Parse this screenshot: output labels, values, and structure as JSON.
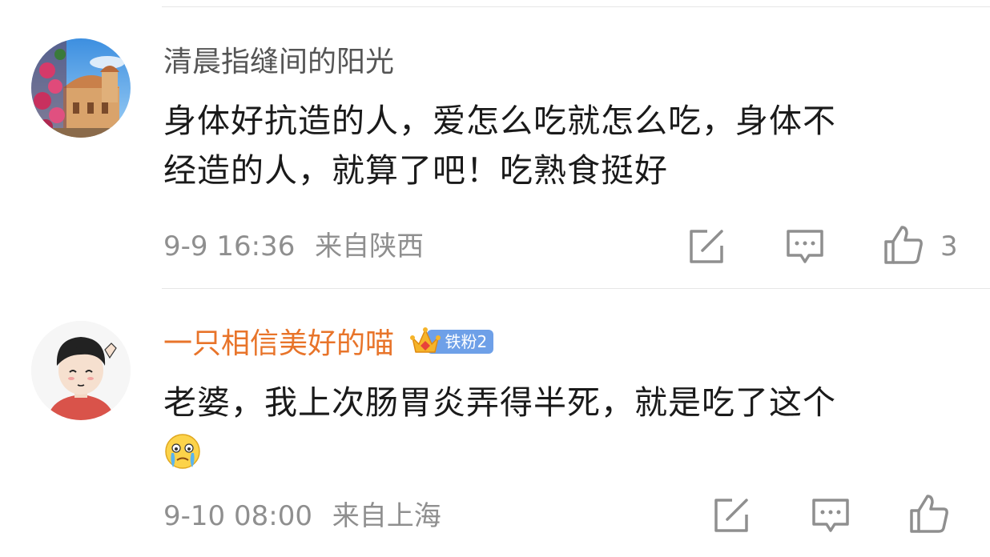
{
  "comments": [
    {
      "username": "清晨指缝间的阳光",
      "username_color": "#555555",
      "lines": [
        "身体好抗造的人，爱怎么吃就怎么吃，身体不",
        "经造的人，就算了吧！吃熟食挺好"
      ],
      "date": "9-9 16:36",
      "location": "来自陕西",
      "like_count": "3",
      "avatar_icon": "church-landscape-avatar"
    },
    {
      "username": "一只相信美好的喵",
      "username_color": "#e8742a",
      "badge": "铁粉2",
      "badge_icon": "crown-icon",
      "lines": [
        "老婆，我上次肠胃炎弄得半死，就是吃了这个"
      ],
      "emoji": "crying-face-emoji",
      "date": "9-10 08:00",
      "location": "来自上海",
      "like_count": "",
      "avatar_icon": "cartoon-boy-avatar"
    }
  ],
  "colors": {
    "meta_gray": "#8f8f8f",
    "divider": "#e6e6e6",
    "text": "#1a1a1a",
    "badge_blue": "#6ea0e8"
  }
}
